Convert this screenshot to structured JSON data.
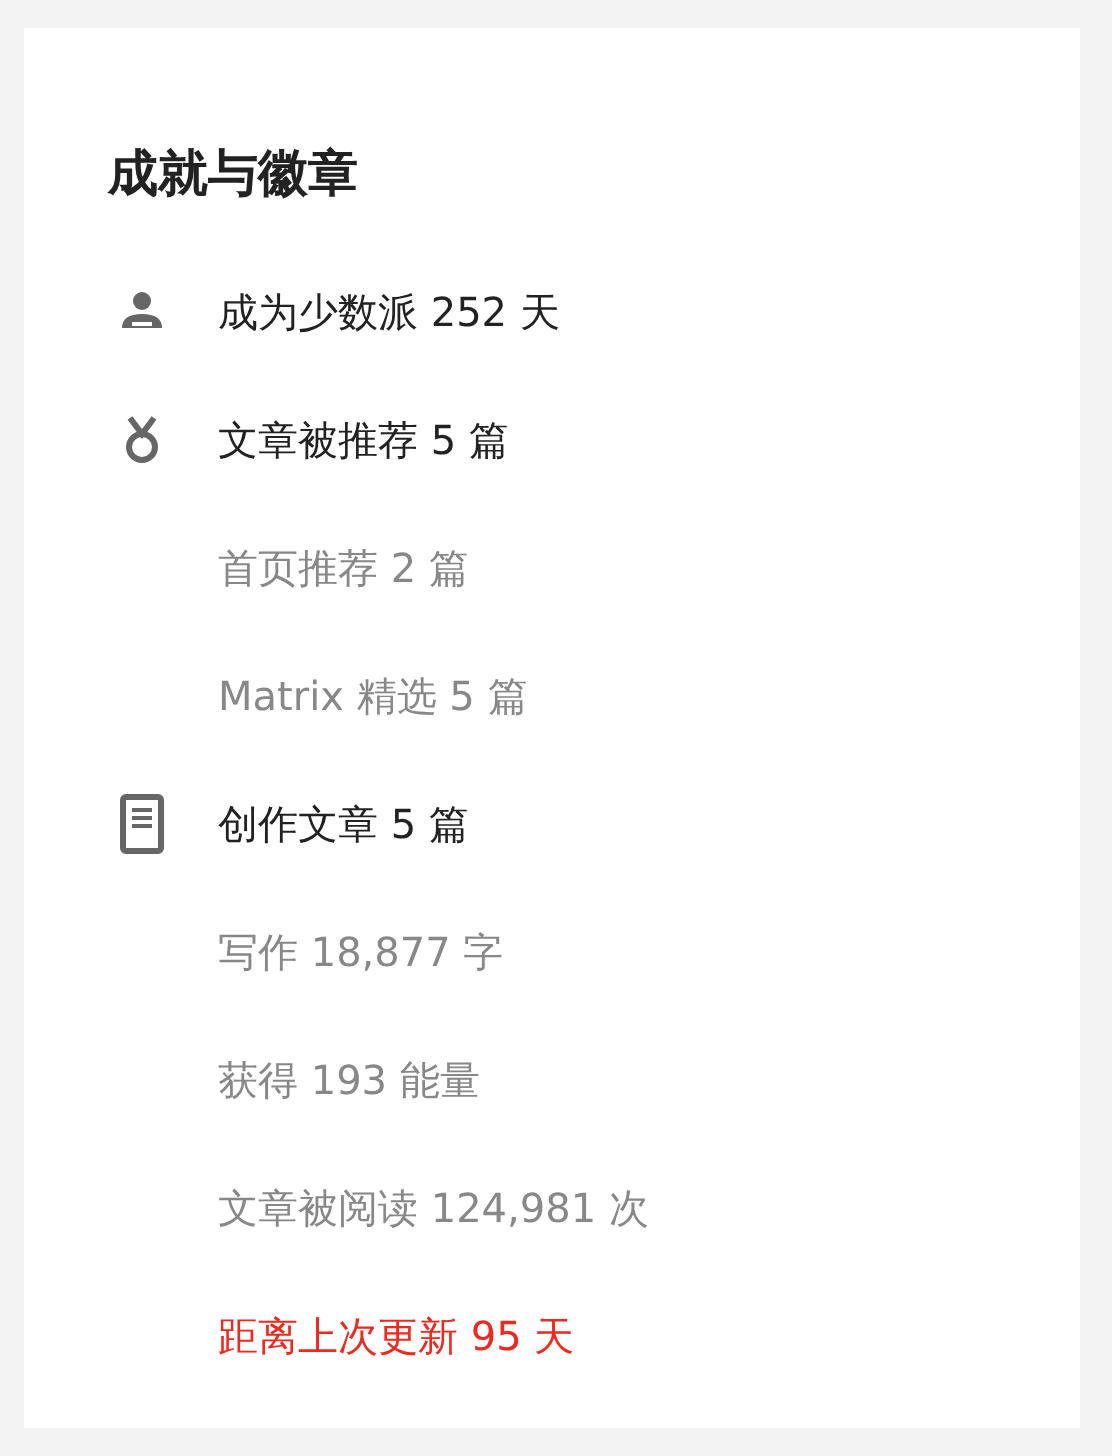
{
  "title": "成就与徽章",
  "rows": [
    {
      "kind": "person",
      "text": "成为少数派 252 天"
    },
    {
      "kind": "medal",
      "text": "文章被推荐 5 篇"
    },
    {
      "kind": "sub",
      "text": "首页推荐 2 篇"
    },
    {
      "kind": "sub",
      "text": "Matrix 精选 5 篇"
    },
    {
      "kind": "document",
      "text": "创作文章 5 篇"
    },
    {
      "kind": "sub",
      "text": "写作 18,877 字"
    },
    {
      "kind": "sub",
      "text": "获得 193 能量"
    },
    {
      "kind": "sub",
      "text": "文章被阅读 124,981 次"
    },
    {
      "kind": "warning",
      "text": "距离上次更新 95 天"
    }
  ]
}
